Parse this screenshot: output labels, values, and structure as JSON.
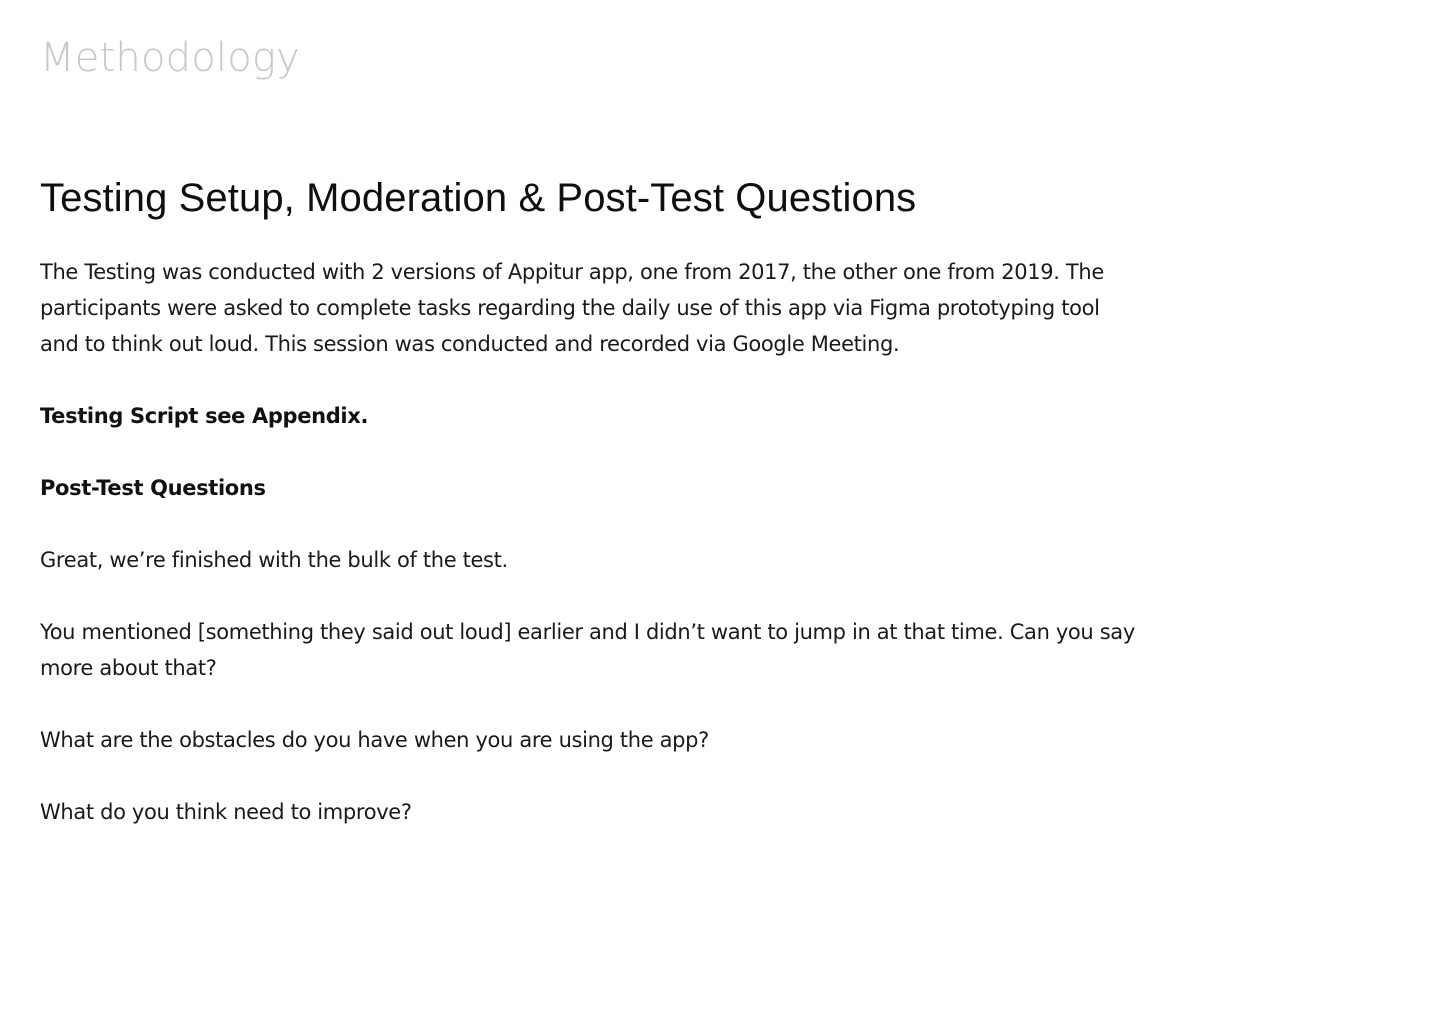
{
  "page": {
    "section_label": "Methodology",
    "heading": "Testing Setup, Moderation & Post-Test Questions",
    "intro": "The Testing was conducted with 2 versions of Appitur app, one from 2017, the other one from 2019. The participants were asked to complete tasks regarding the daily use of this app via Figma prototyping tool and to think out loud. This session was conducted and recorded via Google Meeting.",
    "script_note": "Testing Script see Appendix.",
    "post_test_title": "Post-Test Questions",
    "questions": [
      "Great, we’re finished with the bulk of the test.",
      "You mentioned [something they said out loud] earlier and I didn’t want to jump in at that time. Can you say more about that?",
      "What are the obstacles do you have when you are using the app?",
      "What do you think need to improve?"
    ]
  }
}
